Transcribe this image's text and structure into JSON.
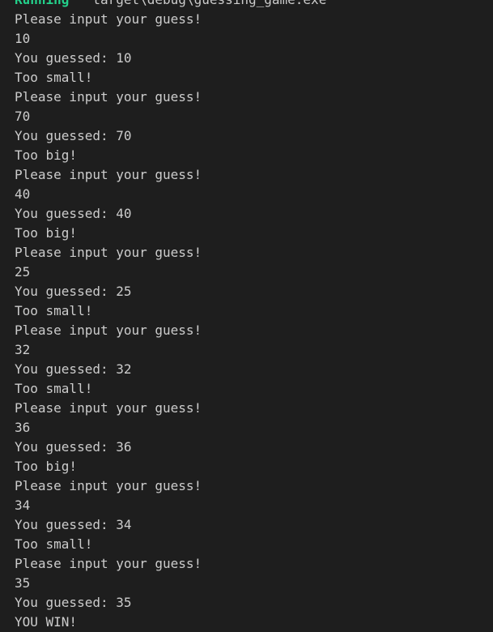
{
  "terminal": {
    "running": {
      "keyword": "Running",
      "path": "`target\\debug\\guessing_game.exe`"
    },
    "lines": [
      "Please input your guess!",
      "10",
      "You guessed: 10",
      "Too small!",
      "Please input your guess!",
      "70",
      "You guessed: 70",
      "Too big!",
      "Please input your guess!",
      "40",
      "You guessed: 40",
      "Too big!",
      "Please input your guess!",
      "25",
      "You guessed: 25",
      "Too small!",
      "Please input your guess!",
      "32",
      "You guessed: 32",
      "Too small!",
      "Please input your guess!",
      "36",
      "You guessed: 36",
      "Too big!",
      "Please input your guess!",
      "34",
      "You guessed: 34",
      "Too small!",
      "Please input your guess!",
      "35",
      "You guessed: 35",
      "YOU WIN!"
    ]
  }
}
